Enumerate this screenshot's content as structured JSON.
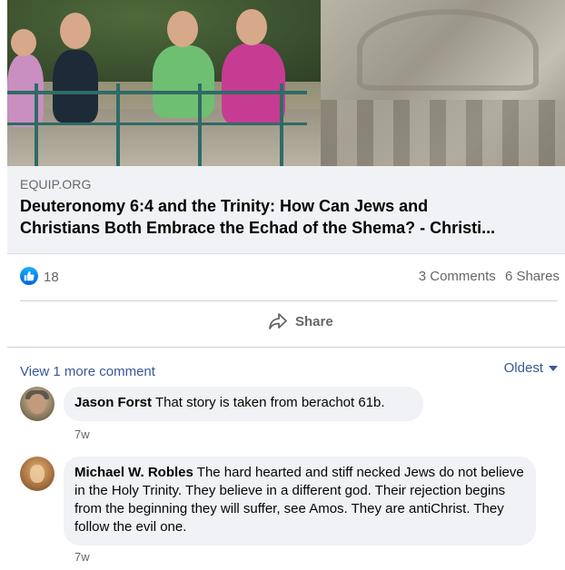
{
  "link_preview": {
    "domain": "EQUIP.ORG",
    "title_line1": "Deuteronomy 6:4 and the Trinity: How Can Jews and",
    "title_line2": "Christians Both Embrace the Echad of the Shema? - Christi..."
  },
  "stats": {
    "reaction_icon": "like-icon",
    "reaction_count": "18",
    "comments": "3 Comments",
    "shares": "6 Shares"
  },
  "actions": {
    "share_label": "Share"
  },
  "comments_section": {
    "view_more": "View 1 more comment",
    "sort_label": "Oldest",
    "comments": [
      {
        "author": "Jason Forst",
        "text": "That story is taken from berachot 61b.",
        "time": "7w"
      },
      {
        "author": "Michael W. Robles",
        "text": "The hard hearted and stiff necked Jews do not believe in the Holy Trinity. They believe in a different god. Their rejection begins from the beginning they will suffer, see Amos. They are antiChrist. They follow the evil one.",
        "time": "7w"
      }
    ]
  },
  "colors": {
    "link_blue": "#385898",
    "secondary_text": "#65676b",
    "bubble_bg": "#f0f2f5",
    "like_blue": "#1877f2"
  }
}
